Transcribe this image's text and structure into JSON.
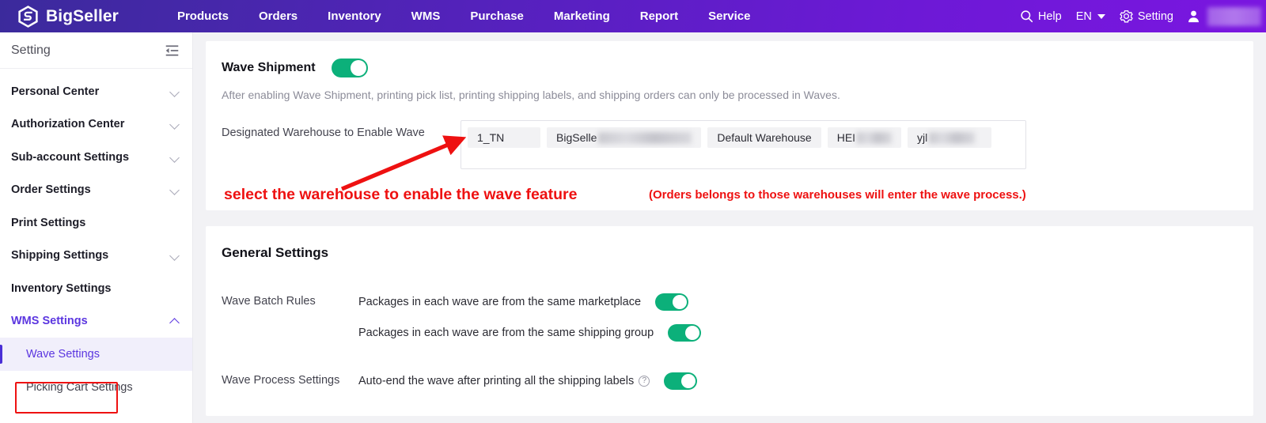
{
  "header": {
    "brand": "BigSeller",
    "logo_icon": "bigseller-hex-logo",
    "nav": [
      {
        "label": "Products"
      },
      {
        "label": "Orders"
      },
      {
        "label": "Inventory"
      },
      {
        "label": "WMS"
      },
      {
        "label": "Purchase"
      },
      {
        "label": "Marketing"
      },
      {
        "label": "Report"
      },
      {
        "label": "Service"
      }
    ],
    "help_label": "Help",
    "language": "EN",
    "setting_label": "Setting",
    "user_name": ""
  },
  "sidebar": {
    "title": "Setting",
    "collapse_icon": "collapse-sidebar-icon",
    "items": [
      {
        "label": "Personal Center",
        "expandable": true,
        "expanded": false
      },
      {
        "label": "Authorization Center",
        "expandable": true,
        "expanded": false
      },
      {
        "label": "Sub-account Settings",
        "expandable": true,
        "expanded": false
      },
      {
        "label": "Order Settings",
        "expandable": true,
        "expanded": false
      },
      {
        "label": "Print Settings",
        "expandable": false,
        "expanded": false
      },
      {
        "label": "Shipping Settings",
        "expandable": true,
        "expanded": false
      },
      {
        "label": "Inventory Settings",
        "expandable": false,
        "expanded": false
      },
      {
        "label": "WMS Settings",
        "expandable": true,
        "expanded": true
      }
    ],
    "sub_items": [
      {
        "label": "Wave Settings",
        "active": true
      },
      {
        "label": "Picking Cart Settings",
        "active": false
      }
    ]
  },
  "main": {
    "wave_shipment": {
      "label": "Wave Shipment",
      "enabled": true,
      "description": "After enabling Wave Shipment, printing pick list, printing shipping labels, and shipping orders can only be processed in Waves."
    },
    "warehouse": {
      "label": "Designated Warehouse to Enable Wave",
      "tags": [
        {
          "text": "1_TN",
          "blur_width": 0
        },
        {
          "text": "BigSelle",
          "blur_width": 118
        },
        {
          "text": "Default Warehouse",
          "blur_width": 0
        },
        {
          "text": "HEI",
          "blur_width": 44
        },
        {
          "text": "yjl",
          "blur_width": 58
        }
      ]
    },
    "general_settings": {
      "title": "General Settings",
      "batch_rules_label": "Wave Batch Rules",
      "batch_rules": [
        {
          "text": "Packages in each wave are from the same marketplace",
          "enabled": true
        },
        {
          "text": "Packages in each wave are from the same shipping group",
          "enabled": true
        }
      ],
      "process_settings_label": "Wave Process Settings",
      "process_settings": [
        {
          "text": "Auto-end the wave after printing all the shipping labels",
          "help_icon": "question-mark-icon",
          "enabled": true
        }
      ]
    }
  },
  "annotations": {
    "arrow": "red-arrow-pointing-to-warehouse-box",
    "primary_text": "select the warehouse to enable the wave feature",
    "secondary_text": "(Orders belongs to those warehouses will enter the wave process.)",
    "highlight_box": "red-box-around-wave-settings",
    "color": "#ee1111"
  },
  "colors": {
    "header_gradient_start": "#3b2a9c",
    "header_gradient_end": "#7a16e0",
    "toggle_on": "#0cb07a",
    "accent_purple": "#5b36e0",
    "annotation_red": "#ee1111"
  }
}
